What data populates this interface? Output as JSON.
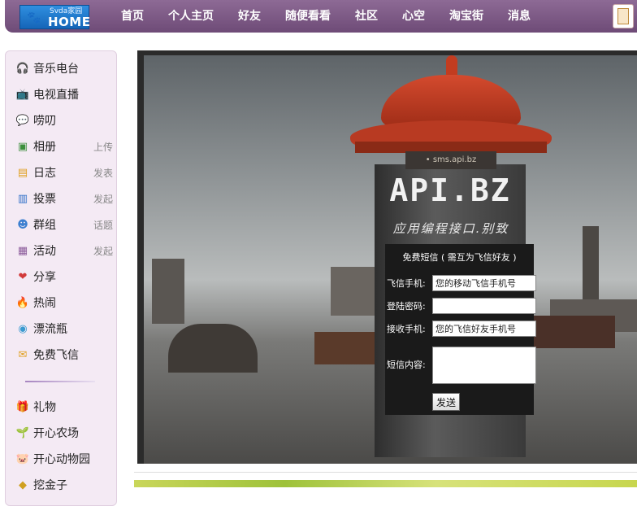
{
  "logo": {
    "small": "Svda家园",
    "big": "HOME"
  },
  "nav": [
    "首页",
    "个人主页",
    "好友",
    "随便看看",
    "社区",
    "心空",
    "淘宝街",
    "消息"
  ],
  "sidebar": {
    "items": [
      {
        "label": "音乐电台",
        "action": "",
        "icon": "headphones-icon",
        "color": "#2f9a3a"
      },
      {
        "label": "电视直播",
        "action": "",
        "icon": "tv-icon",
        "color": "#c0392b"
      },
      {
        "label": "唠叨",
        "action": "",
        "icon": "chat-bubble-icon",
        "color": "#4aa3df"
      },
      {
        "label": "相册",
        "action": "上传",
        "icon": "photo-album-icon",
        "color": "#3d8f3d"
      },
      {
        "label": "日志",
        "action": "发表",
        "icon": "notebook-icon",
        "color": "#e0a020"
      },
      {
        "label": "投票",
        "action": "发起",
        "icon": "bar-chart-icon",
        "color": "#2f6fc8"
      },
      {
        "label": "群组",
        "action": "话题",
        "icon": "group-icon",
        "color": "#3b7fd0"
      },
      {
        "label": "活动",
        "action": "发起",
        "icon": "calendar-icon",
        "color": "#8a5a9a"
      },
      {
        "label": "分享",
        "action": "",
        "icon": "heart-icon",
        "color": "#d23a3a"
      },
      {
        "label": "热闹",
        "action": "",
        "icon": "flame-icon",
        "color": "#e8541e"
      },
      {
        "label": "漂流瓶",
        "action": "",
        "icon": "bottle-icon",
        "color": "#3a9ad0"
      },
      {
        "label": "免费飞信",
        "action": "",
        "icon": "fetion-icon",
        "color": "#e0a020"
      },
      {
        "label": "礼物",
        "action": "",
        "icon": "gift-icon",
        "color": "#c0392b"
      },
      {
        "label": "开心农场",
        "action": "",
        "icon": "sprout-icon",
        "color": "#3f9a2a"
      },
      {
        "label": "开心动物园",
        "action": "",
        "icon": "pig-icon",
        "color": "#e07aa0"
      },
      {
        "label": "挖金子",
        "action": "",
        "icon": "gold-icon",
        "color": "#d0a020"
      }
    ]
  },
  "banner": {
    "ring_text": "• sms.api.bz",
    "title": "API.BZ",
    "subtitle": "应用编程接口.别致"
  },
  "sms_form": {
    "title": "免费短信 ( 需互为飞信好友 )",
    "phone_label": "飞信手机:",
    "phone_value": "您的移动飞信手机号",
    "password_label": "登陆密码:",
    "password_value": "",
    "receiver_label": "接收手机:",
    "receiver_value": "您的飞信好友手机号",
    "content_label": "短信内容:",
    "send_label": "发送"
  }
}
